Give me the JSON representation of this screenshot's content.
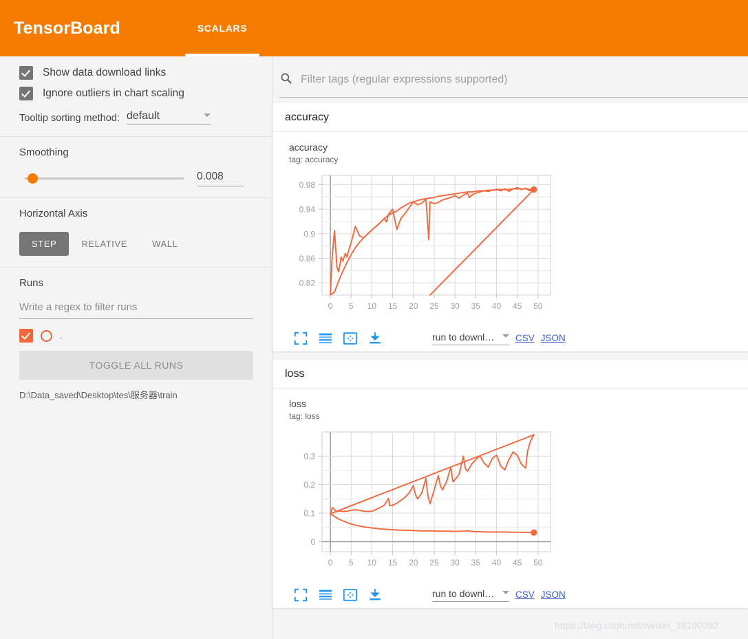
{
  "header": {
    "brand": "TensorBoard",
    "tabs": [
      {
        "label": "SCALARS",
        "active": true
      }
    ],
    "accent_color": "#f57c00"
  },
  "sidebar": {
    "checkboxes": [
      {
        "label": "Show data download links",
        "checked": true
      },
      {
        "label": "Ignore outliers in chart scaling",
        "checked": true
      }
    ],
    "tooltip_sorting": {
      "label": "Tooltip sorting method:",
      "value": "default"
    },
    "smoothing": {
      "title": "Smoothing",
      "value": "0.008"
    },
    "horizontal_axis": {
      "title": "Horizontal Axis",
      "options": [
        {
          "label": "STEP",
          "active": true
        },
        {
          "label": "RELATIVE",
          "active": false
        },
        {
          "label": "WALL",
          "active": false
        }
      ]
    },
    "runs": {
      "title": "Runs",
      "filter_placeholder": "Write a regex to filter runs",
      "run_name": ".",
      "run_color": "#f4663c",
      "toggle_all_label": "TOGGLE ALL RUNS",
      "path": "D:\\Data_saved\\Desktop\\tes\\服务器\\train"
    }
  },
  "main": {
    "filter": {
      "placeholder": "Filter tags (regular expressions supported)",
      "value": ""
    },
    "cards": [
      {
        "header": "accuracy",
        "chart_title": "accuracy",
        "chart_tag": "tag: accuracy",
        "tools": [
          "fullscreen-icon",
          "data-table-icon",
          "fit-domain-icon",
          "download-icon"
        ],
        "download_select": "run to downl…",
        "links": [
          "CSV",
          "JSON"
        ]
      },
      {
        "header": "loss",
        "chart_title": "loss",
        "chart_tag": "tag: loss",
        "tools": [
          "fullscreen-icon",
          "data-table-icon",
          "fit-domain-icon",
          "download-icon"
        ],
        "download_select": "run to downl…",
        "links": [
          "CSV",
          "JSON"
        ]
      }
    ]
  },
  "watermark": "https://blog.csdn.net/weixin_39190382",
  "chart_data": [
    {
      "type": "line",
      "title": "accuracy",
      "tag": "accuracy",
      "xlabel": "",
      "ylabel": "",
      "xlim": [
        -2,
        53
      ],
      "ylim": [
        0.8,
        0.995
      ],
      "xticks": [
        0,
        5,
        10,
        15,
        20,
        25,
        30,
        35,
        40,
        45,
        50
      ],
      "yticks": [
        0.82,
        0.86,
        0.9,
        0.94,
        0.98
      ],
      "grid": true,
      "legend": "none",
      "line_color": "#f4663c",
      "last_point": {
        "x": 49,
        "y": 0.972
      },
      "series": [
        {
          "name": "accuracy-raw",
          "x": [
            0,
            0.4,
            1,
            1.6,
            2,
            2.6,
            3,
            3.6,
            4,
            4.6,
            5,
            6,
            7,
            8,
            9,
            10,
            11,
            12,
            13,
            13.5,
            14,
            15,
            15.5,
            16,
            17,
            18,
            19,
            20,
            21,
            22,
            23,
            23.3,
            23.7,
            24,
            25,
            26,
            27,
            28,
            29,
            30,
            31,
            32,
            33,
            33.5,
            34,
            35,
            36,
            37,
            38,
            39,
            40,
            41,
            42,
            43,
            44,
            45,
            46,
            47,
            48,
            49
          ],
          "y": [
            0.795,
            0.86,
            0.905,
            0.845,
            0.838,
            0.862,
            0.855,
            0.868,
            0.862,
            0.877,
            0.885,
            0.912,
            0.897,
            0.893,
            0.9,
            0.906,
            0.912,
            0.918,
            0.925,
            0.919,
            0.932,
            0.94,
            0.923,
            0.907,
            0.925,
            0.933,
            0.943,
            0.952,
            0.947,
            0.95,
            0.956,
            0.93,
            0.89,
            0.952,
            0.949,
            0.951,
            0.955,
            0.957,
            0.959,
            0.962,
            0.958,
            0.963,
            0.966,
            0.959,
            0.963,
            0.966,
            0.968,
            0.97,
            0.969,
            0.971,
            0.972,
            0.97,
            0.973,
            0.969,
            0.973,
            0.975,
            0.972,
            0.974,
            0.97,
            0.972
          ]
        },
        {
          "name": "accuracy-smoothed",
          "x": [
            0,
            1,
            2,
            3,
            4,
            5,
            6,
            7,
            8,
            9,
            10,
            11,
            12,
            13,
            14,
            15,
            16,
            17,
            18,
            19,
            20,
            21,
            22,
            23,
            24,
            25,
            26,
            27,
            28,
            29,
            30,
            31,
            32,
            33,
            34,
            35,
            36,
            37,
            38,
            39,
            40,
            41,
            42,
            43,
            44,
            45,
            46,
            47,
            48,
            49
          ],
          "y": [
            0.787,
            0.805,
            0.823,
            0.839,
            0.853,
            0.866,
            0.877,
            0.886,
            0.893,
            0.9,
            0.906,
            0.912,
            0.918,
            0.925,
            0.93,
            0.934,
            0.937,
            0.942,
            0.946,
            0.95,
            0.952,
            0.954,
            0.956,
            0.957,
            0.958,
            0.959,
            0.961,
            0.962,
            0.963,
            0.964,
            0.965,
            0.966,
            0.967,
            0.968,
            0.968,
            0.969,
            0.97,
            0.97,
            0.971,
            0.971,
            0.972,
            0.972,
            0.972,
            0.972,
            0.973,
            0.973,
            0.973,
            0.973,
            0.972,
            0.972
          ]
        },
        {
          "name": "accuracy-wrap",
          "x": [
            24,
            49
          ],
          "y": [
            0.8,
            0.972
          ]
        }
      ]
    },
    {
      "type": "line",
      "title": "loss",
      "tag": "loss",
      "xlabel": "",
      "ylabel": "",
      "xlim": [
        -2,
        53
      ],
      "ylim": [
        -0.035,
        0.385
      ],
      "xticks": [
        0,
        5,
        10,
        15,
        20,
        25,
        30,
        35,
        40,
        45,
        50
      ],
      "yticks": [
        0,
        0.1,
        0.2,
        0.3
      ],
      "grid": true,
      "legend": "none",
      "line_color": "#f4663c",
      "last_point": {
        "x": 49,
        "y": 0.032
      },
      "series": [
        {
          "name": "loss-raw",
          "x": [
            0,
            0.5,
            1,
            1.5,
            2,
            3,
            4,
            5,
            6,
            7,
            8,
            9,
            10,
            11,
            12,
            13,
            14,
            14.3,
            15,
            16,
            17,
            18,
            19,
            20,
            20.5,
            21,
            22,
            23,
            23.5,
            24,
            25,
            26,
            26.5,
            27,
            28,
            29,
            29.5,
            30,
            31,
            32,
            32.5,
            33,
            34,
            35,
            36,
            37,
            38,
            39,
            40,
            41,
            42,
            43,
            44,
            45,
            46,
            47,
            47.5,
            48,
            48.5,
            49
          ],
          "y": [
            0.098,
            0.12,
            0.113,
            0.105,
            0.108,
            0.106,
            0.107,
            0.11,
            0.112,
            0.11,
            0.107,
            0.106,
            0.107,
            0.113,
            0.12,
            0.128,
            0.152,
            0.126,
            0.128,
            0.135,
            0.145,
            0.156,
            0.172,
            0.197,
            0.165,
            0.15,
            0.17,
            0.222,
            0.16,
            0.133,
            0.182,
            0.232,
            0.196,
            0.182,
            0.212,
            0.262,
            0.21,
            0.218,
            0.236,
            0.3,
            0.256,
            0.247,
            0.272,
            0.288,
            0.301,
            0.276,
            0.262,
            0.292,
            0.304,
            0.266,
            0.252,
            0.288,
            0.315,
            0.303,
            0.272,
            0.258,
            0.318,
            0.345,
            0.362,
            0.375
          ]
        },
        {
          "name": "loss-envelope",
          "x": [
            0,
            49
          ],
          "y": [
            0.098,
            0.375
          ]
        },
        {
          "name": "loss-smoothed",
          "x": [
            0,
            1,
            2,
            3,
            4,
            5,
            6,
            7,
            8,
            9,
            10,
            12,
            14,
            16,
            18,
            20,
            22,
            24,
            26,
            28,
            30,
            32,
            33,
            34,
            35,
            36,
            38,
            40,
            42,
            44,
            46,
            48,
            49
          ],
          "y": [
            0.098,
            0.088,
            0.08,
            0.073,
            0.067,
            0.062,
            0.058,
            0.055,
            0.052,
            0.05,
            0.048,
            0.045,
            0.043,
            0.041,
            0.04,
            0.039,
            0.038,
            0.038,
            0.037,
            0.037,
            0.036,
            0.037,
            0.038,
            0.036,
            0.035,
            0.035,
            0.034,
            0.034,
            0.034,
            0.033,
            0.033,
            0.032,
            0.032
          ]
        }
      ]
    }
  ]
}
